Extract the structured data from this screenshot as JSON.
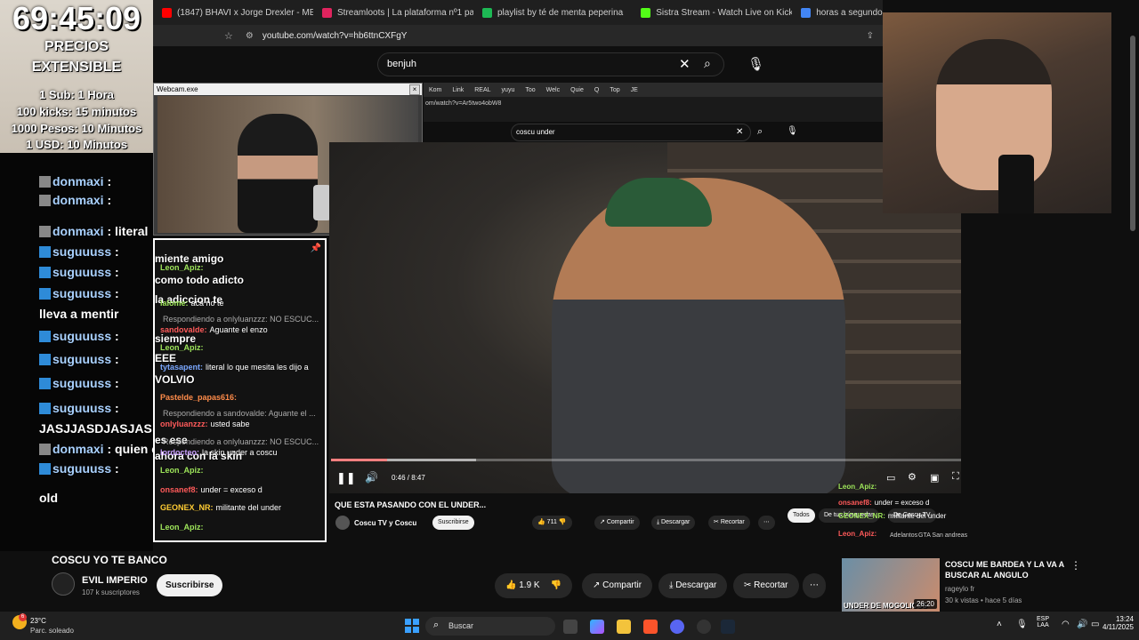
{
  "overlay": {
    "timer": "69:45:09",
    "prices_title": "PRECIOS",
    "extensible": "EXTENSIBLE",
    "rates": [
      "1 Sub: 1 Hora",
      "100 kicks: 15 minutos",
      "1000 Pesos: 10 Minutos",
      "1 USD: 10 Minutos"
    ]
  },
  "browser": {
    "tabs": [
      {
        "label": "(1847) BHAVI x Jorge Drexler - ME DE",
        "color": "#ff0000"
      },
      {
        "label": "Streamloots | La plataforma nº1 para",
        "color": "#e0245e"
      },
      {
        "label": "playlist by té de menta peperina",
        "color": "#1db954"
      },
      {
        "label": "Sistra Stream - Watch Live on Kick",
        "color": "#53fc18"
      },
      {
        "label": "horas a segundos - Buscar con Goog",
        "color": "#4285f4"
      }
    ],
    "url": "youtube.com/watch?v=hb6ttnCXFgY"
  },
  "yt_search": {
    "query": "benjuh"
  },
  "left_chat": [
    {
      "user": "donmaxi",
      "text": ""
    },
    {
      "user": "donmaxi",
      "text": ""
    },
    {
      "user": "donmaxi",
      "text": "literal"
    },
    {
      "user": "suguuuss",
      "text": ""
    },
    {
      "user": "suguuuss",
      "text": ""
    },
    {
      "user": "suguuuss",
      "text": ""
    },
    {
      "user": "",
      "text": "lleva a mentir"
    },
    {
      "user": "suguuuss",
      "text": ""
    },
    {
      "user": "suguuuss",
      "text": ""
    },
    {
      "user": "suguuuss",
      "text": ""
    },
    {
      "user": "suguuuss",
      "text": ""
    },
    {
      "user": "",
      "text": "JASJJASDJASJAS"
    },
    {
      "user": "donmaxi",
      "text": "quien es ese"
    },
    {
      "user": "suguuuss",
      "text": ""
    },
    {
      "user": "",
      "text": "old"
    }
  ],
  "webcam": {
    "title": "Webcam.exe"
  },
  "inner_chat": {
    "big_messages": [
      "miente amigo",
      "como todo adicto",
      "la adiccion te",
      "siempre",
      "EEE",
      "VOLVIO",
      "es ese",
      "ahora con la skin"
    ],
    "messages": [
      {
        "user": "Leon_Apiz:",
        "text": "",
        "color": "#9ee65a"
      },
      {
        "user": "lalome:",
        "text": "aca no te",
        "color": "#9ee65a"
      },
      {
        "user": "",
        "text": "Respondiendo a onlyluanzzz: NO ESCUC...",
        "color": "#aaaaaa"
      },
      {
        "user": "sandovalde:",
        "text": "Aguante el enzo",
        "color": "#ff5a5a"
      },
      {
        "user": "Leon_Apiz:",
        "text": "",
        "color": "#9ee65a"
      },
      {
        "user": "tytasapent:",
        "text": "literal lo que mesita les dijo a",
        "color": "#7aa7ff"
      },
      {
        "user": "Pastelde_papas616:",
        "text": "",
        "color": "#ff8c4a"
      },
      {
        "user": "",
        "text": "Respondiendo a sandovalde: Aguante el ...",
        "color": "#aaaaaa"
      },
      {
        "user": "onlyluanzzz:",
        "text": "usted sabe",
        "color": "#ff5a5a"
      },
      {
        "user": "",
        "text": "Respondiendo a onlyluanzzz: NO ESCUC...",
        "color": "#aaaaaa"
      },
      {
        "user": "lordocteo:",
        "text": "la skin under a coscu",
        "color": "#c9a0ff"
      },
      {
        "user": "Leon_Apiz:",
        "text": "",
        "color": "#9ee65a"
      },
      {
        "user": "onsanef8:",
        "text": "under = exceso d",
        "color": "#ff5a5a"
      },
      {
        "user": "GEONEX_NR:",
        "text": "militante del under",
        "color": "#ffcc33"
      },
      {
        "user": "Leon_Apiz:",
        "text": "",
        "color": "#9ee65a"
      }
    ]
  },
  "inner_browser": {
    "tabs": [
      "Kom",
      "Link",
      "REAL",
      "yuyu",
      "Too",
      "Welc",
      "Quie",
      "Q",
      "Top",
      "JE"
    ],
    "url": "om/watch?v=Ar5two4obW8",
    "search": "coscu under"
  },
  "inner_video": {
    "time": "0:46 / 8:47",
    "progress": 0.089,
    "title": "QUE ESTA PASANDO CON EL UNDER...",
    "channel": "Coscu TV y Coscu",
    "subscribe": "Suscribirse",
    "likes": "711",
    "share": "Compartir",
    "download": "Descargar",
    "clip": "Recortar",
    "chips": [
      "Todos",
      "De tus búsquedas",
      "De Coscu TV"
    ],
    "overlay_chat": [
      {
        "user": "Leon_Apiz:",
        "text": ""
      },
      {
        "user": "onsanef8:",
        "text": "under = exceso d"
      },
      {
        "user": "GEONEX_NR:",
        "text": "militante del under"
      },
      {
        "user": "Leon_Apiz:",
        "text": ""
      }
    ],
    "side_hint": [
      "Adelantos",
      "GTA San andreas"
    ]
  },
  "video": {
    "title": "COSCU YO TE BANCO",
    "channel": "EVIL IMPERIO",
    "subscribers": "107 k suscriptores",
    "subscribe": "Suscribirse",
    "likes": "1.9 K",
    "share": "Compartir",
    "download": "Descargar",
    "clip": "Recortar"
  },
  "related": {
    "title": "COSCU ME BARDEA Y LA VA A BUSCAR AL ANGULO",
    "channel": "rageylo fr",
    "meta": "30 k vistas • hace 5 días",
    "thumb_text": "UNDER DE MOGOLICOS",
    "duration": "26:20"
  },
  "taskbar": {
    "weather_temp": "23°C",
    "weather_desc": "Parc. soleado",
    "weather_badge": "6",
    "search": "Buscar",
    "lang": "ESP",
    "lang2": "LAA",
    "time": "13:24",
    "date": "4/11/2025"
  }
}
